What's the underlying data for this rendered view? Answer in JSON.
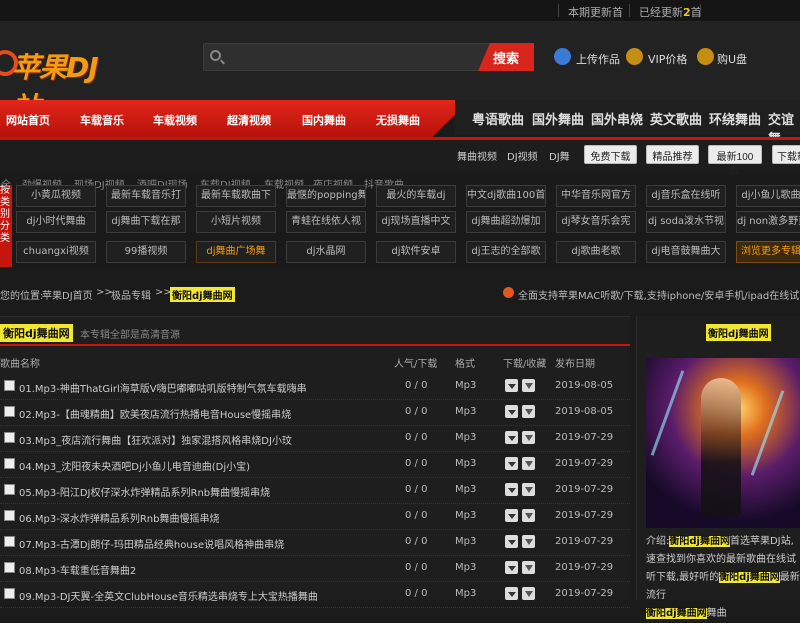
{
  "topbar": {
    "today_update": "本期更新首",
    "updated_prefix": "已经更新",
    "updated_count": "2",
    "updated_suffix": "首"
  },
  "brand": {
    "logo_text": "苹果DJ站"
  },
  "search": {
    "placeholder": "",
    "button": "搜索"
  },
  "header_links": [
    {
      "label": "上传作品",
      "icon": "upload-icon"
    },
    {
      "label": "VIP价格",
      "icon": "vip-icon"
    },
    {
      "label": "购U盘",
      "icon": "usb-icon"
    }
  ],
  "main_nav": [
    "网站首页",
    "车载音乐",
    "车载视频",
    "超清视频",
    "国内舞曲",
    "无损舞曲"
  ],
  "dark_nav": [
    "粤语歌曲",
    "国外舞曲",
    "国外串烧",
    "英文歌曲",
    "环绕舞曲",
    "交谊舞"
  ],
  "sub_links": [
    "舞曲视频",
    "DJ视频",
    "DJ舞"
  ],
  "sub_buttons": [
    "免费下载",
    "精品推荐",
    "最新100首",
    "下载帮"
  ],
  "category_tabs": [
    "全",
    "劲爆视频",
    "现场DJ视频",
    "酒吧DJ现场",
    "车载DJ视频",
    "车载视频",
    "夜店视频",
    "抖音歌曲"
  ],
  "category_side": "按类别分类",
  "categories_row1": [
    "小黄瓜视频",
    "最新车载音乐打",
    "最新车载歌曲下",
    "最惬的popping舞",
    "最火的车载dj",
    "中文dj歌曲100首",
    "中华音乐网官方",
    "dj音乐盒在线听",
    "dj小鱼儿歌曲"
  ],
  "categories_row2": [
    "dj小时代舞曲",
    "dj舞曲下载在那",
    "小短片视频",
    "青蛙在线依人视",
    "dj现场直播中文",
    "dj舞曲超劲爆加",
    "dj琴女音乐会宪",
    "dj soda泼水节视",
    "dj non激多野蛮"
  ],
  "categories_row3": [
    "chuangxi视频",
    "99播视频",
    "dj舞曲广场舞",
    "dj水晶网",
    "dj软件安卓",
    "dj王志的全部歌",
    "dj歌曲老歌",
    "dj电音鼓舞曲大",
    "浏览更多专辑"
  ],
  "breadcrumb": {
    "prefix": "您的位置:",
    "home": "苹果DJ首页",
    "sep1": ">>",
    "mid": "极品专辑",
    "sep2": ">>",
    "current": "衡阳dj舞曲网"
  },
  "notice": "全面支持苹果MAC听歌/下载,支持iphone/安卓手机/ipad在线试听",
  "panel": {
    "title": "衡阳dj舞曲网",
    "subtitle": "本专辑全部是高清音源"
  },
  "columns": {
    "name": "歌曲名称",
    "stats": "人气/下载",
    "format": "格式",
    "actions": "下载/收藏",
    "date": "发布日期"
  },
  "songs": [
    {
      "name": "01.Mp3-神曲ThatGirl海草版V嗨巴嘟嘟咕叽版特制气氛车载嗨串",
      "stats": "0 / 0",
      "format": "Mp3",
      "date": "2019-08-05"
    },
    {
      "name": "02.Mp3-【曲魂精曲】欧美夜店流行热播电音House慢摇串烧",
      "stats": "0 / 0",
      "format": "Mp3",
      "date": "2019-08-05"
    },
    {
      "name": "03.Mp3_夜店流行舞曲【狂欢派对】独家混搭风格串烧DJ小玟",
      "stats": "0 / 0",
      "format": "Mp3",
      "date": "2019-07-29"
    },
    {
      "name": "04.Mp3_沈阳夜未央酒吧Dj小鱼儿电音迪曲(Dj小宝)",
      "stats": "0 / 0",
      "format": "Mp3",
      "date": "2019-07-29"
    },
    {
      "name": "05.Mp3-阳江DJ权仔深水炸弹精品系列Rnb舞曲慢摇串烧",
      "stats": "0 / 0",
      "format": "Mp3",
      "date": "2019-07-29"
    },
    {
      "name": "06.Mp3-深水炸弹精品系列Rnb舞曲慢摇串烧",
      "stats": "0 / 0",
      "format": "Mp3",
      "date": "2019-07-29"
    },
    {
      "name": "07.Mp3-古潭Dj朗仔-玛田精品经典house说唱风格神曲串烧",
      "stats": "0 / 0",
      "format": "Mp3",
      "date": "2019-07-29"
    },
    {
      "name": "08.Mp3-车载重低音舞曲2",
      "stats": "0 / 0",
      "format": "Mp3",
      "date": "2019-07-29"
    },
    {
      "name": "09.Mp3-DJ天翼-全英文ClubHouse音乐精选串烧专上大宝热播舞曲",
      "stats": "0 / 0",
      "format": "Mp3",
      "date": "2019-07-29"
    }
  ],
  "side": {
    "title": "衡阳dj舞曲网",
    "desc_prefix": "介绍:",
    "desc_hl1": "衡阳dj舞曲网",
    "desc_mid1": "首选苹果DJ站,速查找到你喜欢的最新歌曲在线试听下载,最好听的",
    "desc_hl2": "衡阳dj舞曲网",
    "desc_mid2": "最新流行",
    "desc_hl3": "衡阳dj舞曲网",
    "desc_end": "舞曲"
  },
  "colors": {
    "accent_red": "#d9261c",
    "highlight_yellow": "#f1e634",
    "orange": "#f39c12"
  }
}
